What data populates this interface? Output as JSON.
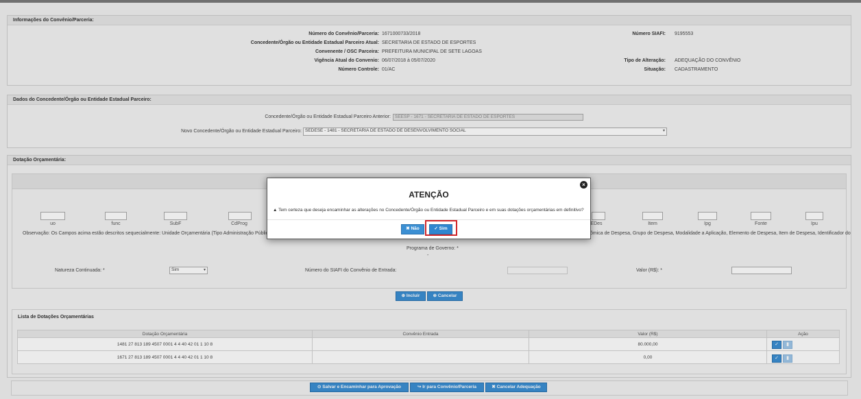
{
  "info": {
    "title": "Informações do Convênio/Parceria:",
    "numero_convenio_label": "Número do Convênio/Parceria:",
    "numero_convenio": "1671000733/2018",
    "concedente_label": "Concedente/Órgão ou Entidade Estadual Parceiro Atual:",
    "concedente": "SECRETARIA DE ESTADO DE ESPORTES",
    "convenente_label": "Convenente / OSC Parceira:",
    "convenente": "PREFEITURA MUNICIPAL DE SETE LAGOAS",
    "vigencia_label": "Vigência Atual do Convenio:",
    "vigencia": "06/07/2018 à 05/07/2020",
    "numero_controle_label": "Número Controle:",
    "numero_controle": "01/AC",
    "numero_siafi_label": "Número SIAFI:",
    "numero_siafi": "9195553",
    "tipo_alteracao_label": "Tipo de Alteração:",
    "tipo_alteracao": "ADEQUAÇÃO DO CONVÊNIO",
    "situacao_label": "Situação:",
    "situacao": "CADASTRAMENTO"
  },
  "dados": {
    "title": "Dados do Concedente/Órgão ou Entidade Estadual Parceiro:",
    "anterior_label": "Concedente/Órgão ou Entidade Estadual Parceiro Anterior:",
    "anterior_value": "SEESP - 1671 - SECRETARIA DE ESTADO DE ESPORTES",
    "novo_label": "Novo Concedente/Órgão ou Entidade Estadual Parceiro:",
    "novo_value": "SEDESE - 1481 - SECRETARIA DE ESTADO DE DESENVOLVIMENTO SOCIAL"
  },
  "dotacao": {
    "title": "Dotação Orçamentária:",
    "fields_left": [
      "uo",
      "func",
      "SubF",
      "CdProg"
    ],
    "fields_right": [
      "EDes",
      "Item",
      "Ipg",
      "Fonte",
      "Ipu"
    ],
    "obs_left": "Observação: Os Campos acima estão descritos sequecialmente: Unidade Orçamentária (Tipo Administração Pública + Uni",
    "obs_right": "ômica de Despesa, Grupo de Despesa, Modalidade a Aplicação, Elemento de Despesa, Item de Despesa, Identificador do",
    "programa_label": "Programa de Governo: *",
    "programa_value": "-",
    "natureza_label": "Natureza Continuada: *",
    "natureza_value": "Sim",
    "siafi_entrada_label": "Número do SIAFI do Convênio de Entrada:",
    "valor_label": "Valor (R$): *",
    "incluir": "Incluir",
    "cancelar": "Cancelar"
  },
  "lista": {
    "title": "Lista de Dotações Orçamentárias",
    "headers": [
      "Dotação Orçamentária",
      "Convênio Entrada",
      "Valor (R$)",
      "Ação"
    ],
    "rows": [
      {
        "dotacao": "1481 27 813 189 4507 0001 4 4 40 42 01 1 10 8",
        "convenio": "",
        "valor": "80.000,00"
      },
      {
        "dotacao": "1671 27 813 189 4507 0001 4 4 40 42 01 1 10 8",
        "convenio": "",
        "valor": "0,00"
      }
    ]
  },
  "footer": {
    "salvar": "Salvar e Encaminhar para Aprovação",
    "ir": "Ir para Convênio/Parceria",
    "cancelar_adequacao": "Cancelar Adequação"
  },
  "modal": {
    "title": "ATENÇÃO",
    "message": "Tem certeza que deseja encaminhar as alterações no Concedente/Órgão ou Entidade Estadual Parceiro e em suas dotações orçamentárias em definitivo?",
    "no": "Não",
    "yes": "Sim"
  },
  "icons": {
    "close": "close-icon",
    "warning": "warning-icon",
    "check": "check-icon"
  },
  "colors": {
    "primary_button": "#3b8fd3",
    "highlight": "#d0262a"
  }
}
